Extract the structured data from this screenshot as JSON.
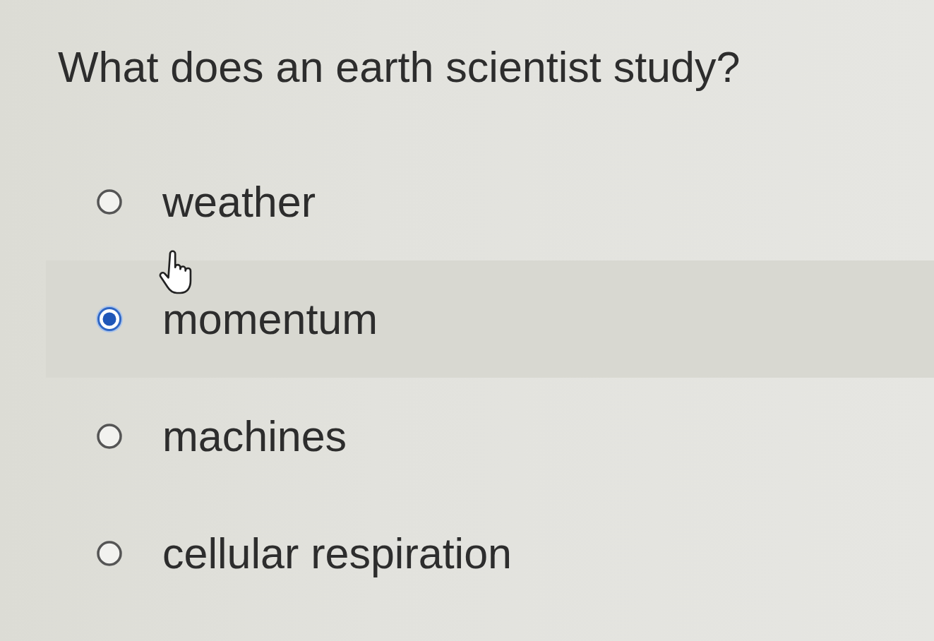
{
  "question": {
    "text": "What does an earth scientist study?"
  },
  "options": [
    {
      "label": "weather",
      "selected": false
    },
    {
      "label": "momentum",
      "selected": true
    },
    {
      "label": "machines",
      "selected": false
    },
    {
      "label": "cellular respiration",
      "selected": false
    }
  ]
}
